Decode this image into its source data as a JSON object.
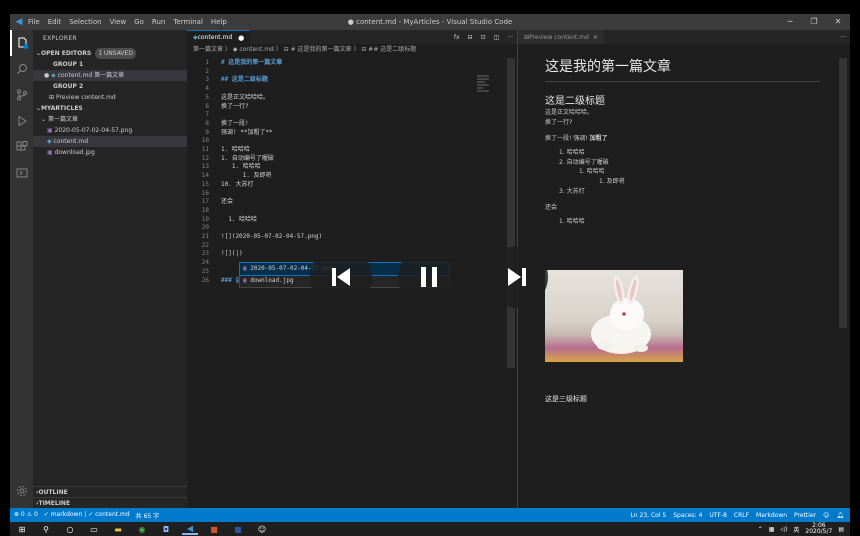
{
  "window": {
    "title": "● content.md - MyArticles - Visual Studio Code",
    "menu": [
      "File",
      "Edit",
      "Selection",
      "View",
      "Go",
      "Run",
      "Terminal",
      "Help"
    ]
  },
  "sidebar": {
    "title": "EXPLORER",
    "open_editors_label": "OPEN EDITORS",
    "unsaved_badge": "1 UNSAVED",
    "group1_label": "GROUP 1",
    "group1_file": "content.md 第一篇文章",
    "group2_label": "GROUP 2",
    "group2_file": "Preview content.md",
    "project_label": "MYARTICLES",
    "folder_name": "第一篇文章",
    "files": [
      "2020-05-07-02-04-57.png",
      "content.md",
      "download.jpg"
    ],
    "outline_label": "OUTLINE",
    "timeline_label": "TIMELINE"
  },
  "editor": {
    "tab_label": "content.md",
    "breadcrumb": "第一篇文章 〉 ◆ content.md 〉 ⊟ # 这是我的第一篇文章 〉 ⊟ ## 这是二级标题",
    "lines": [
      {
        "n": "1",
        "t": "# 这是我的第一篇文章"
      },
      {
        "n": "2",
        "t": ""
      },
      {
        "n": "3",
        "t": "## 这是二级标题"
      },
      {
        "n": "4",
        "t": ""
      },
      {
        "n": "5",
        "t": "这是正文哈哈哈。"
      },
      {
        "n": "6",
        "t": "换了一行?"
      },
      {
        "n": "7",
        "t": ""
      },
      {
        "n": "8",
        "t": "换了一段!"
      },
      {
        "n": "9",
        "t": "强调! **加粗了**"
      },
      {
        "n": "10",
        "t": ""
      },
      {
        "n": "11",
        "t": "1. 哈哈哈"
      },
      {
        "n": "12",
        "t": "1. 自动编号了喔破"
      },
      {
        "n": "13",
        "t": "   1. 哈哈哈"
      },
      {
        "n": "14",
        "t": "      1. 及即将"
      },
      {
        "n": "15",
        "t": "10. 大苏打"
      },
      {
        "n": "16",
        "t": ""
      },
      {
        "n": "17",
        "t": "还会"
      },
      {
        "n": "18",
        "t": ""
      },
      {
        "n": "19",
        "t": "  1. 哈哈哈"
      },
      {
        "n": "20",
        "t": ""
      },
      {
        "n": "21",
        "t": "![](2020-05-07-02-04-57.png)"
      },
      {
        "n": "22",
        "t": ""
      },
      {
        "n": "23",
        "t": "![](|)"
      },
      {
        "n": "24",
        "t": ""
      },
      {
        "n": "25",
        "t": ""
      },
      {
        "n": "26",
        "t": "### 这是三级标题"
      }
    ],
    "suggestions": [
      "2020-05-07-02-04-57.png",
      "download.jpg"
    ]
  },
  "preview": {
    "tab_label": "Preview content.md",
    "h1": "这是我的第一篇文章",
    "h2": "这是二级标题",
    "p1_line1": "这是正文哈哈哈。",
    "p1_line2": "换了一行?",
    "p2_prefix": "换了一段! 强调!",
    "p2_bold": "加粗了",
    "list": [
      "1. 哈哈哈",
      "2. 自动编号了喔破",
      "1. 哈哈哈",
      "1. 及即将",
      "3. 大苏打"
    ],
    "p3": "还会",
    "list2": [
      "1. 哈哈哈"
    ],
    "h3": "这是三级标题"
  },
  "status": {
    "left": [
      "⊗ 0 ⚠ 0",
      "✓ markdown | ✓ content.md",
      "共 65 字"
    ],
    "right": [
      "Ln 23, Col 5",
      "Spaces: 4",
      "UTF-8",
      "CRLF",
      "Markdown",
      "Prettier"
    ]
  },
  "taskbar": {
    "time": "2:06",
    "date": "2020/5/7",
    "ime": "英"
  }
}
